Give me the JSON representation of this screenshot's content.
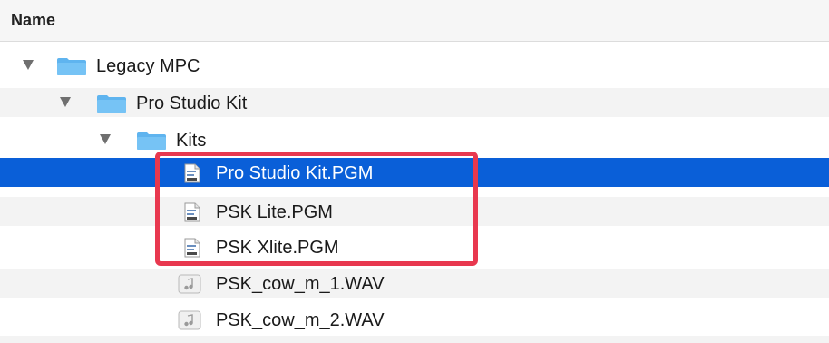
{
  "header": {
    "column_name": "Name"
  },
  "rows": [
    {
      "label": "Legacy MPC",
      "type": "folder",
      "expanded": true,
      "icon": "folder-icon"
    },
    {
      "label": "Pro Studio Kit",
      "type": "folder",
      "expanded": true,
      "icon": "folder-icon"
    },
    {
      "label": "Kits",
      "type": "folder",
      "expanded": true,
      "icon": "folder-icon"
    },
    {
      "label": "Pro Studio Kit.PGM",
      "type": "program-file",
      "selected": true,
      "icon": "program-file-icon"
    },
    {
      "label": "PSK Lite.PGM",
      "type": "program-file",
      "icon": "program-file-icon"
    },
    {
      "label": "PSK Xlite.PGM",
      "type": "program-file",
      "icon": "program-file-icon"
    },
    {
      "label": "PSK_cow_m_1.WAV",
      "type": "audio-file",
      "icon": "audio-file-icon"
    },
    {
      "label": "PSK_cow_m_2.WAV",
      "type": "audio-file",
      "icon": "audio-file-icon"
    }
  ],
  "colors": {
    "selection": "#0a5fd8",
    "annotation": "#e8384f",
    "folder": "#5fb4ef"
  }
}
